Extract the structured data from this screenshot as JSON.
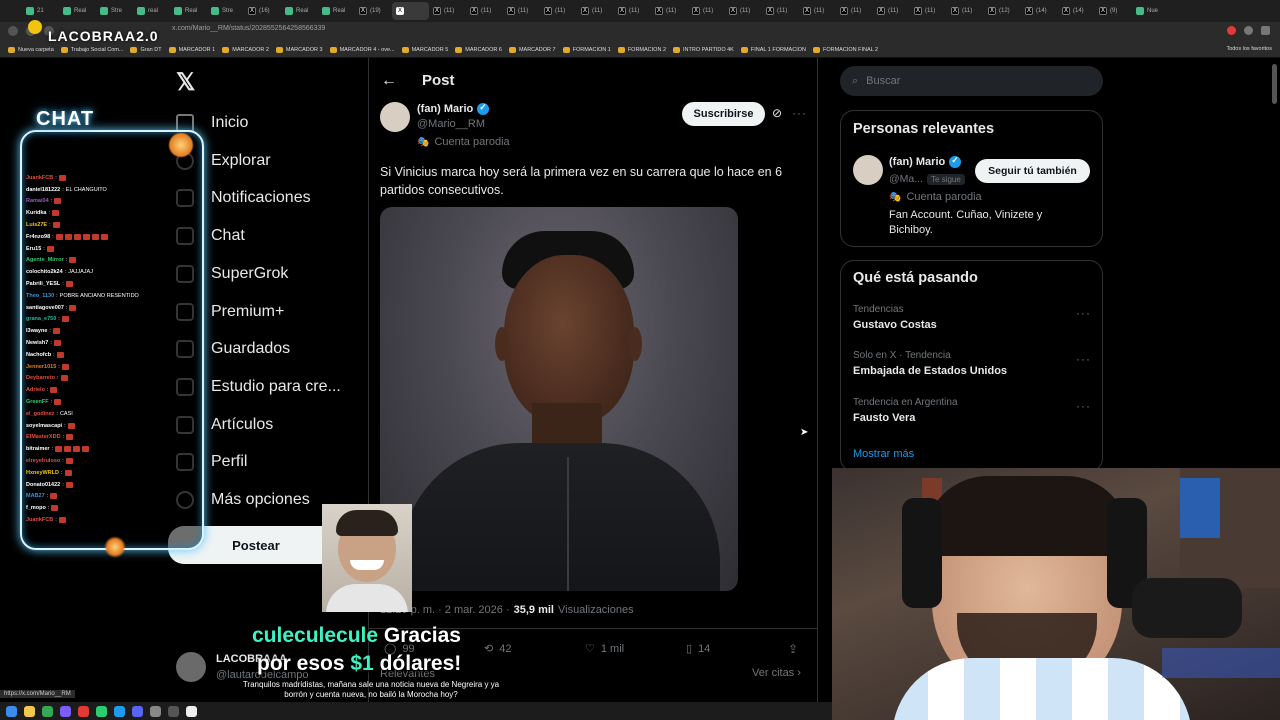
{
  "browser": {
    "tabs": [
      "21",
      "Real",
      "Stre",
      "real",
      "Real",
      "Stre",
      "(16)",
      "Real",
      "Real",
      "(19)",
      "",
      "(11)",
      "(11)",
      "(11)",
      "(11)",
      "(11)",
      "(11)",
      "(11)",
      "(11)",
      "(11)",
      "(11)",
      "(11)",
      "(11)",
      "(11)",
      "(11)",
      "(11)",
      "(12)",
      "(14)",
      "(14)",
      "(9)",
      "Nue"
    ],
    "url": "x.com/Mario__RM/status/2028552564258566339",
    "bookmarks": [
      "Nueva carpeta",
      "Trabajo Social Com...",
      "Gran DT",
      "MARCADOR 1",
      "MARCADOR 2",
      "MARCADOR 3",
      "MARCADOR 4 - ove...",
      "MARCADOR 5",
      "MARCADOR 6",
      "MARCADOR 7",
      "FORMACION 1",
      "FORMACION 2",
      "INTRO PARTIDO 4K",
      "FINAL 1 FORMACION",
      "FORMACION FINAL 2"
    ],
    "all_bookmarks": "Todos los favoritos",
    "status_url": "https://x.com/Mario__RM"
  },
  "overlay": {
    "brand": "LACOBRAA2.0",
    "chat_title": "CHAT",
    "chat": [
      {
        "name": "JuankFCB",
        "text": "",
        "c": "#e74c3c",
        "e": 1
      },
      {
        "name": "daniel181222",
        "text": "EL CHANGUITO",
        "c": "#ffffff",
        "e": 0
      },
      {
        "name": "Ramai04",
        "text": "",
        "c": "#9b59b6",
        "e": 1
      },
      {
        "name": "Kuridka",
        "text": "",
        "c": "#ffffff",
        "e": 1
      },
      {
        "name": "Luis27E",
        "text": "",
        "c": "#f1c40f",
        "e": 1
      },
      {
        "name": "Fr4nzo98",
        "text": "",
        "c": "#ffffff",
        "e": 6
      },
      {
        "name": "Eru15",
        "text": "",
        "c": "#ffffff",
        "e": 1
      },
      {
        "name": "Agente_Mirror",
        "text": "",
        "c": "#2ecc71",
        "e": 1
      },
      {
        "name": "colochito2k24",
        "text": "JAJJAJAJ",
        "c": "#ffffff",
        "e": 0
      },
      {
        "name": "Pabrili_YESL",
        "text": "",
        "c": "#ffffff",
        "e": 1
      },
      {
        "name": "Theo_1130",
        "text": "POBRE ANCIANO RESENTIDO",
        "c": "#3498db",
        "e": 0
      },
      {
        "name": "santiagove007",
        "text": "",
        "c": "#ffffff",
        "e": 1
      },
      {
        "name": "grana_e750",
        "text": "",
        "c": "#1abc9c",
        "e": 1
      },
      {
        "name": "l3wayne",
        "text": "",
        "c": "#ffffff",
        "e": 1
      },
      {
        "name": "Newish7",
        "text": "",
        "c": "#ffffff",
        "e": 1
      },
      {
        "name": "Nachofcb",
        "text": "",
        "c": "#ffffff",
        "e": 1
      },
      {
        "name": "Jenner1015",
        "text": "",
        "c": "#e67e22",
        "e": 1
      },
      {
        "name": "Deybarreto",
        "text": "",
        "c": "#e74c3c",
        "e": 1
      },
      {
        "name": "Adrielo",
        "text": "",
        "c": "#e74c3c",
        "e": 1
      },
      {
        "name": "GreenFF",
        "text": "",
        "c": "#2ecc71",
        "e": 1
      },
      {
        "name": "el_godinez",
        "text": "CASI",
        "c": "#e74c3c",
        "e": 0
      },
      {
        "name": "soyelmascapi",
        "text": "",
        "c": "#ffffff",
        "e": 1
      },
      {
        "name": "ElMasterXDD",
        "text": "",
        "c": "#e74c3c",
        "e": 1
      },
      {
        "name": "bitraimer",
        "text": "",
        "c": "#ffffff",
        "e": 4
      },
      {
        "name": "elreyelruloso",
        "text": "",
        "c": "#e74c3c",
        "e": 1
      },
      {
        "name": "HxneyWRLD",
        "text": "",
        "c": "#f1c40f",
        "e": 1
      },
      {
        "name": "Donato01422",
        "text": "",
        "c": "#ffffff",
        "e": 1
      },
      {
        "name": "MAB27",
        "text": "",
        "c": "#3498db",
        "e": 1
      },
      {
        "name": "f_mopo",
        "text": "",
        "c": "#ffffff",
        "e": 1
      },
      {
        "name": "JuankFCB",
        "text": "",
        "c": "#e74c3c",
        "e": 1
      }
    ],
    "donation_user": "culeculecule",
    "donation_msg1": "Gracias",
    "donation_msg2a": "por esos",
    "donation_amount": "$1",
    "donation_msg2b": "dólares!",
    "donation_sub": "Tranquilos madridistas, mañana sale una noticia nueva de Negreira y ya borrón y cuenta nueva, no bailó la Morocha hoy?"
  },
  "nav": {
    "items": [
      "Inicio",
      "Explorar",
      "Notificaciones",
      "Chat",
      "SuperGrok",
      "Premium+",
      "Guardados",
      "Estudio para cre...",
      "Artículos",
      "Perfil",
      "Más opciones"
    ],
    "post_button": "Postear",
    "account_name": "LACOBRAAA",
    "account_handle": "@lautarodelcampo"
  },
  "post": {
    "header": "Post",
    "author": "(fan) Mario",
    "handle": "@Mario__RM",
    "parody": "Cuenta parodia",
    "subscribe": "Suscribirse",
    "text": "Si Vinicius marca hoy será la primera vez en su carrera que lo hace en 6 partidos consecutivos.",
    "time": "12:26 p. m. · 2 mar. 2026 ·",
    "views": "35,9 mil",
    "views_label": "Visualizaciones",
    "replies": "99",
    "reposts": "42",
    "likes": "1 mil",
    "bookmarks": "14",
    "relevant": "Relevantes",
    "quotes": "Ver citas"
  },
  "sidebar": {
    "search_placeholder": "Buscar",
    "relevant_title": "Personas relevantes",
    "person_name": "(fan) Mario",
    "person_handle": "@Ma...",
    "follows_you": "Te sigue",
    "follow_back": "Seguir tú también",
    "person_parody": "Cuenta parodia",
    "person_bio": "Fan Account. Cuñao, Vinizete y Bichiboy.",
    "trending_title": "Qué está pasando",
    "trends": [
      {
        "context": "Tendencias",
        "name": "Gustavo Costas"
      },
      {
        "context": "Solo en X · Tendencia",
        "name": "Embajada de Estados Unidos"
      },
      {
        "context": "Tendencia en Argentina",
        "name": "Fausto Vera"
      }
    ],
    "show_more": "Mostrar más"
  }
}
